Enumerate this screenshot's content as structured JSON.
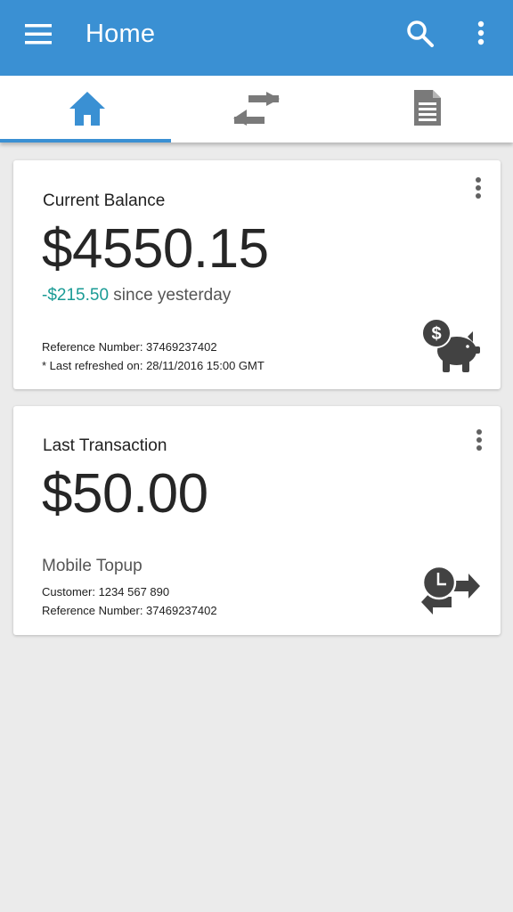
{
  "app": {
    "title": "Home"
  },
  "tabs": [
    {
      "icon": "home-icon",
      "selected": true
    },
    {
      "icon": "swap-arrows-icon",
      "selected": false
    },
    {
      "icon": "document-icon",
      "selected": false
    }
  ],
  "balance_card": {
    "label": "Current Balance",
    "amount": "$4550.15",
    "change_amount": "-$215.50",
    "change_text": " since yesterday",
    "reference": "Reference Number: 37469237402",
    "refreshed": "* Last refreshed on: 28/11/2016 15:00 GMT",
    "icon": "piggy-bank-dollar-icon"
  },
  "transaction_card": {
    "label": "Last Transaction",
    "amount": "$50.00",
    "type": "Mobile Topup",
    "customer": "Customer: 1234 567 890",
    "reference": "Reference Number: 37469237402",
    "icon": "transaction-history-icon"
  },
  "colors": {
    "primary": "#3a90d3",
    "negative_change": "#1a9b95",
    "icon_gray": "#424242",
    "inactive_tab_icon": "#7a7a7a"
  }
}
